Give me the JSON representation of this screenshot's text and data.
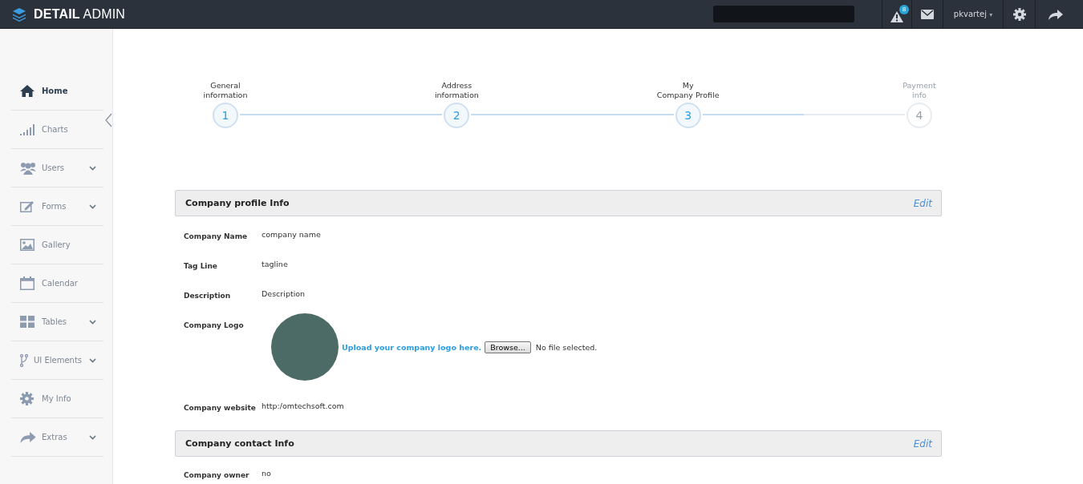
{
  "brand": {
    "bold": "DETAIL",
    "light": "ADMIN"
  },
  "topbar": {
    "alert_count": "8",
    "username": "pkvartej",
    "username_caret": "▾"
  },
  "sidebar": {
    "items": [
      {
        "label": "Home",
        "selected": true,
        "expandable": false
      },
      {
        "label": "Charts",
        "selected": false,
        "expandable": false
      },
      {
        "label": "Users",
        "selected": false,
        "expandable": true
      },
      {
        "label": "Forms",
        "selected": false,
        "expandable": true
      },
      {
        "label": "Gallery",
        "selected": false,
        "expandable": false
      },
      {
        "label": "Calendar",
        "selected": false,
        "expandable": false
      },
      {
        "label": "Tables",
        "selected": false,
        "expandable": true
      },
      {
        "label": "UI Elements",
        "selected": false,
        "expandable": true
      },
      {
        "label": "My Info",
        "selected": false,
        "expandable": false
      },
      {
        "label": "Extras",
        "selected": false,
        "expandable": true
      }
    ]
  },
  "steps": [
    {
      "number": "1",
      "label_lines": [
        "General",
        "information"
      ],
      "active": true
    },
    {
      "number": "2",
      "label_lines": [
        "Address",
        "information"
      ],
      "active": true
    },
    {
      "number": "3",
      "label_lines": [
        "My",
        "Company Profile"
      ],
      "active": true
    },
    {
      "number": "4",
      "label_lines": [
        "Payment",
        "info"
      ],
      "active": false
    }
  ],
  "sections": [
    {
      "title": "Company profile Info",
      "edit": "Edit",
      "fields": [
        {
          "kind": "text",
          "label": "Company Name",
          "value": "company name"
        },
        {
          "kind": "text",
          "label": "Tag Line",
          "value": "tagline"
        },
        {
          "kind": "text",
          "label": "Description",
          "value": "Description"
        },
        {
          "kind": "logo",
          "label": "Company Logo",
          "upload_text": "Upload your company logo here.",
          "browse": "Browse...",
          "file_status": "No file selected."
        },
        {
          "kind": "text",
          "label": "Company website",
          "value": "http:/omtechsoft.com"
        }
      ]
    },
    {
      "title": "Company contact Info",
      "edit": "Edit",
      "fields": [
        {
          "kind": "text",
          "label": "Company owner",
          "value": "no"
        }
      ]
    }
  ]
}
